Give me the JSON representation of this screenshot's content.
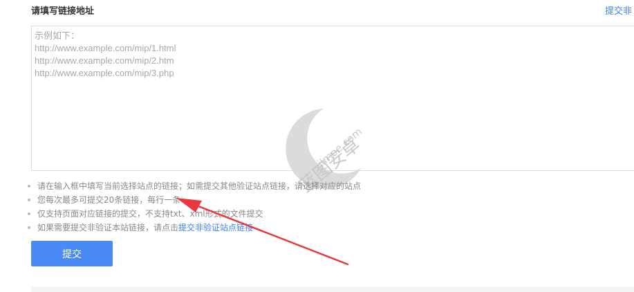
{
  "form": {
    "title": "请填写链接地址",
    "top_link": "提交非",
    "textarea_placeholder": "示例如下：\nhttp://www.example.com/mip/1.html\nhttp://www.example.com/mip/2.htm\nhttp://www.example.com/mip/3.php",
    "submit_label": "提交"
  },
  "tips": [
    {
      "text": "请在输入框中填写当前选择站点的链接；如需提交其他验证站点链接，请选择对应的站点"
    },
    {
      "text": "您每次最多可提交20条链接，每行一条"
    },
    {
      "text": "仅支持页面对应链接的提交，不支持txt、xml形式的文件提交"
    },
    {
      "text": "如果需要提交非验证本站链接，请点击",
      "link": "提交非验证站点链接"
    }
  ],
  "watermark": {
    "text": "蓝图安卓",
    "domain": ".jlmoe.com"
  },
  "colors": {
    "accent": "#4a8af4",
    "link": "#3d7ff7",
    "annotation_arrow": "#e8383d"
  },
  "icons": {
    "watermark_logo": "crescent-moon-icon",
    "annotation": "red-arrow-icon"
  }
}
